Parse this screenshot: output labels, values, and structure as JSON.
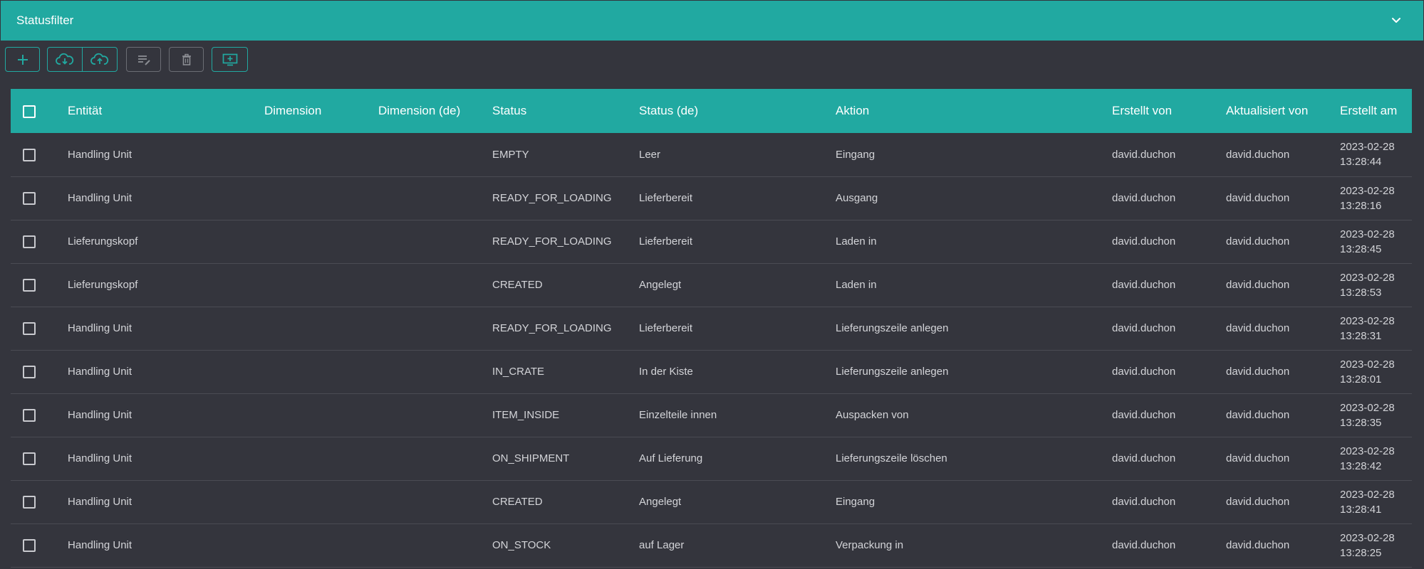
{
  "header": {
    "title": "Statusfilter",
    "collapse_icon": "chevron-down-icon"
  },
  "toolbar": {
    "buttons": [
      {
        "icon": "plus-icon",
        "enabled": true
      },
      {
        "icon": "cloud-download-icon",
        "enabled": true
      },
      {
        "icon": "cloud-upload-icon",
        "enabled": true
      },
      {
        "icon": "edit-list-icon",
        "enabled": false
      },
      {
        "icon": "trash-icon",
        "enabled": false
      },
      {
        "icon": "add-screen-icon",
        "enabled": true
      }
    ]
  },
  "table": {
    "columns": [
      "Entität",
      "Dimension",
      "Dimension (de)",
      "Status",
      "Status (de)",
      "Aktion",
      "Erstellt von",
      "Aktualisiert von",
      "Erstellt am"
    ],
    "rows": [
      {
        "entity": "Handling Unit",
        "dimension": "",
        "dimension_de": "",
        "status": "EMPTY",
        "status_de": "Leer",
        "action": "Eingang",
        "created_by": "david.duchon",
        "updated_by": "david.duchon",
        "created_date": "2023-02-28",
        "created_time": "13:28:44"
      },
      {
        "entity": "Handling Unit",
        "dimension": "",
        "dimension_de": "",
        "status": "READY_FOR_LOADING",
        "status_de": "Lieferbereit",
        "action": "Ausgang",
        "created_by": "david.duchon",
        "updated_by": "david.duchon",
        "created_date": "2023-02-28",
        "created_time": "13:28:16"
      },
      {
        "entity": "Lieferungskopf",
        "dimension": "",
        "dimension_de": "",
        "status": "READY_FOR_LOADING",
        "status_de": "Lieferbereit",
        "action": "Laden in",
        "created_by": "david.duchon",
        "updated_by": "david.duchon",
        "created_date": "2023-02-28",
        "created_time": "13:28:45"
      },
      {
        "entity": "Lieferungskopf",
        "dimension": "",
        "dimension_de": "",
        "status": "CREATED",
        "status_de": "Angelegt",
        "action": "Laden in",
        "created_by": "david.duchon",
        "updated_by": "david.duchon",
        "created_date": "2023-02-28",
        "created_time": "13:28:53"
      },
      {
        "entity": "Handling Unit",
        "dimension": "",
        "dimension_de": "",
        "status": "READY_FOR_LOADING",
        "status_de": "Lieferbereit",
        "action": "Lieferungszeile anlegen",
        "created_by": "david.duchon",
        "updated_by": "david.duchon",
        "created_date": "2023-02-28",
        "created_time": "13:28:31"
      },
      {
        "entity": "Handling Unit",
        "dimension": "",
        "dimension_de": "",
        "status": "IN_CRATE",
        "status_de": "In der Kiste",
        "action": "Lieferungszeile anlegen",
        "created_by": "david.duchon",
        "updated_by": "david.duchon",
        "created_date": "2023-02-28",
        "created_time": "13:28:01"
      },
      {
        "entity": "Handling Unit",
        "dimension": "",
        "dimension_de": "",
        "status": "ITEM_INSIDE",
        "status_de": "Einzelteile innen",
        "action": "Auspacken von",
        "created_by": "david.duchon",
        "updated_by": "david.duchon",
        "created_date": "2023-02-28",
        "created_time": "13:28:35"
      },
      {
        "entity": "Handling Unit",
        "dimension": "",
        "dimension_de": "",
        "status": "ON_SHIPMENT",
        "status_de": "Auf Lieferung",
        "action": "Lieferungszeile löschen",
        "created_by": "david.duchon",
        "updated_by": "david.duchon",
        "created_date": "2023-02-28",
        "created_time": "13:28:42"
      },
      {
        "entity": "Handling Unit",
        "dimension": "",
        "dimension_de": "",
        "status": "CREATED",
        "status_de": "Angelegt",
        "action": "Eingang",
        "created_by": "david.duchon",
        "updated_by": "david.duchon",
        "created_date": "2023-02-28",
        "created_time": "13:28:41"
      },
      {
        "entity": "Handling Unit",
        "dimension": "",
        "dimension_de": "",
        "status": "ON_STOCK",
        "status_de": "auf Lager",
        "action": "Verpackung in",
        "created_by": "david.duchon",
        "updated_by": "david.duchon",
        "created_date": "2023-02-28",
        "created_time": "13:28:25"
      }
    ]
  },
  "colors": {
    "accent": "#21a9a1",
    "background": "#34353d",
    "row_divider": "#4a4b53",
    "disabled_border": "#6b6d74"
  }
}
